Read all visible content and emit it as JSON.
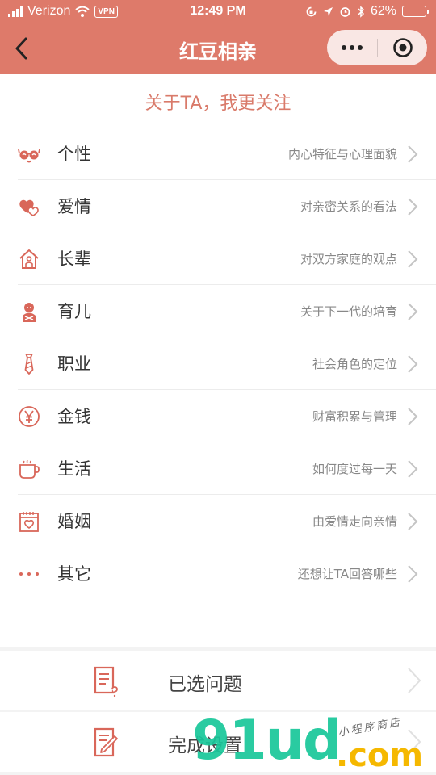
{
  "status_bar": {
    "carrier": "Verizon",
    "vpn": "VPN",
    "time": "12:49 PM",
    "battery": "62%",
    "battery_level": 0.62
  },
  "nav": {
    "title": "红豆相亲"
  },
  "section_title": "关于TA，我更关注",
  "categories": [
    {
      "label": "个性",
      "desc": "内心特征与心理面貌",
      "icon": "glasses-icon"
    },
    {
      "label": "爱情",
      "desc": "对亲密关系的看法",
      "icon": "hearts-icon"
    },
    {
      "label": "长辈",
      "desc": "对双方家庭的观点",
      "icon": "house-icon"
    },
    {
      "label": "育儿",
      "desc": "关于下一代的培育",
      "icon": "baby-icon"
    },
    {
      "label": "职业",
      "desc": "社会角色的定位",
      "icon": "tie-icon"
    },
    {
      "label": "金钱",
      "desc": "财富积累与管理",
      "icon": "yuan-icon"
    },
    {
      "label": "生活",
      "desc": "如何度过每一天",
      "icon": "cup-icon"
    },
    {
      "label": "婚姻",
      "desc": "由爱情走向亲情",
      "icon": "calendar-heart-icon"
    },
    {
      "label": "其它",
      "desc": "还想让TA回答哪些",
      "icon": "more-dots-icon"
    }
  ],
  "actions": {
    "selected": "已选问题",
    "finish": "完成设置"
  },
  "watermark": {
    "brand": "91ud",
    "domain": ".com",
    "tagline": "小程序商店"
  },
  "colors": {
    "accent": "#de7a6a",
    "icon": "#d9675a"
  }
}
